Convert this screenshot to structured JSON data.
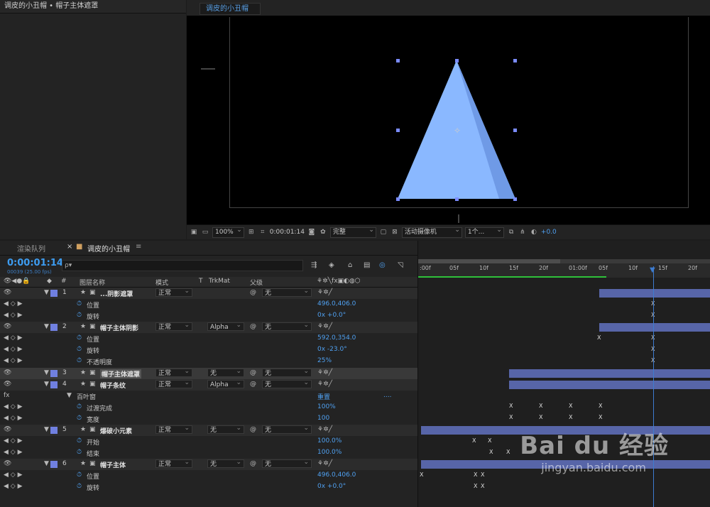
{
  "project_panel": {
    "title": "调皮的小丑帽 • 帽子主体遮罩"
  },
  "comp_viewer": {
    "tab": "调皮的小丑帽",
    "zoom": "100%",
    "timecode": "0:00:01:14",
    "resolution": "完整",
    "camera": "活动摄像机",
    "views": "1个...",
    "exposure": "+0.0"
  },
  "timeline": {
    "tabs": [
      "渲染队列",
      "调皮的小丑帽"
    ],
    "timecode": "0:00:01:14",
    "fps": "00039 (25.00 fps)",
    "search_placeholder": "ρ▾",
    "columns": {
      "num": "#",
      "name": "图层名称",
      "mode": "模式",
      "t": "T",
      "trkmat": "TrkMat",
      "parent": "父级"
    },
    "ruler_ticks": [
      ":00f",
      "05f",
      "10f",
      "15f",
      "20f",
      "01:00f",
      "05f",
      "10f",
      "15f",
      "20f"
    ],
    "rows": [
      {
        "kind": "layer",
        "num": "1",
        "name": "...阴影遮罩",
        "mode": "正常",
        "trkmat": "",
        "parent": "无"
      },
      {
        "kind": "prop",
        "name": "位置",
        "value": "496.0,406.0"
      },
      {
        "kind": "prop",
        "name": "旋转",
        "value": "0x +0.0°"
      },
      {
        "kind": "layer",
        "num": "2",
        "name": "帽子主体阴影",
        "mode": "正常",
        "trkmat": "Alpha",
        "parent": "无"
      },
      {
        "kind": "prop",
        "name": "位置",
        "value": "592.0,354.0"
      },
      {
        "kind": "prop",
        "name": "旋转",
        "value": "0x -23.0°"
      },
      {
        "kind": "prop",
        "name": "不透明度",
        "value": "25%"
      },
      {
        "kind": "layer",
        "num": "3",
        "name": "帽子主体遮罩",
        "mode": "正常",
        "trkmat": "无",
        "parent": "无"
      },
      {
        "kind": "layer",
        "num": "4",
        "name": "帽子条纹",
        "mode": "正常",
        "trkmat": "Alpha",
        "parent": "无"
      },
      {
        "kind": "effect",
        "name": "百叶窗",
        "value": "重置",
        "extra": "...."
      },
      {
        "kind": "prop",
        "name": "过渡完成",
        "value": "100%"
      },
      {
        "kind": "prop",
        "name": "宽度",
        "value": "100"
      },
      {
        "kind": "layer",
        "num": "5",
        "name": "爆破小元素",
        "mode": "正常",
        "trkmat": "无",
        "parent": "无"
      },
      {
        "kind": "prop",
        "name": "开始",
        "value": "100.0%"
      },
      {
        "kind": "prop",
        "name": "结束",
        "value": "100.0%"
      },
      {
        "kind": "layer",
        "num": "6",
        "name": "帽子主体",
        "mode": "正常",
        "trkmat": "无",
        "parent": "无"
      },
      {
        "kind": "prop",
        "name": "位置",
        "value": "496.0,406.0"
      },
      {
        "kind": "prop",
        "name": "旋转",
        "value": "0x +0.0°"
      }
    ]
  },
  "watermark": {
    "brand": "Bai  du 经验",
    "url": "jingyan.baidu.com"
  },
  "colors": {
    "accent": "#3d9cf0",
    "shape": "#8ab8ff",
    "layer_label": "#7080e0"
  }
}
